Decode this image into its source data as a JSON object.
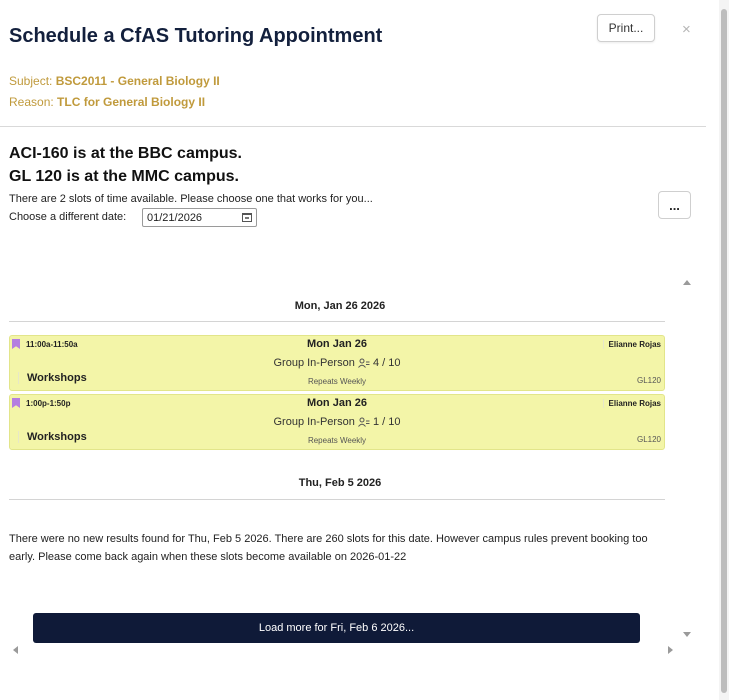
{
  "header": {
    "title": "Schedule a CfAS Tutoring Appointment",
    "print_label": "Print...",
    "close_icon": "close-icon",
    "subject_label": "Subject:",
    "subject_value": "BSC2011 - General Biology II",
    "reason_label": "Reason:",
    "reason_value": "TLC for General Biology II"
  },
  "info": {
    "line1": "ACI-160 is at the BBC campus.",
    "line2": "GL 120 is at the MMC campus.",
    "slots_text": "There are 2 slots of time available. Please choose one that works for you...",
    "date_label": "Choose a different date:",
    "date_value": "01/21/2026",
    "more_label": "..."
  },
  "results": {
    "date1": "Mon, Jan 26 2026",
    "slots": [
      {
        "time": "11:00a-11:50a",
        "day": "Mon Jan 26",
        "mode": "Group In-Person",
        "count": "4 / 10",
        "tutor": "Elianne Rojas",
        "type": "Workshops",
        "repeat": "Repeats Weekly",
        "room": "GL120"
      },
      {
        "time": "1:00p-1:50p",
        "day": "Mon Jan 26",
        "mode": "Group In-Person",
        "count": "1 / 10",
        "tutor": "Elianne Rojas",
        "type": "Workshops",
        "repeat": "Repeats Weekly",
        "room": "GL120"
      }
    ],
    "date2": "Thu, Feb 5 2026",
    "no_results": "There were no new results found for Thu, Feb 5 2026. There are 260 slots for this date. However campus rules prevent booking too early. Please come back again when these slots become available on 2026-01-22",
    "load_more": "Load more for Fri, Feb 6 2026..."
  },
  "colors": {
    "title": "#13203d",
    "meta": "#c09a3c",
    "slot_bg": "#f3f5a8",
    "flag": "#b47fe0",
    "load_button": "#0f1a38"
  }
}
